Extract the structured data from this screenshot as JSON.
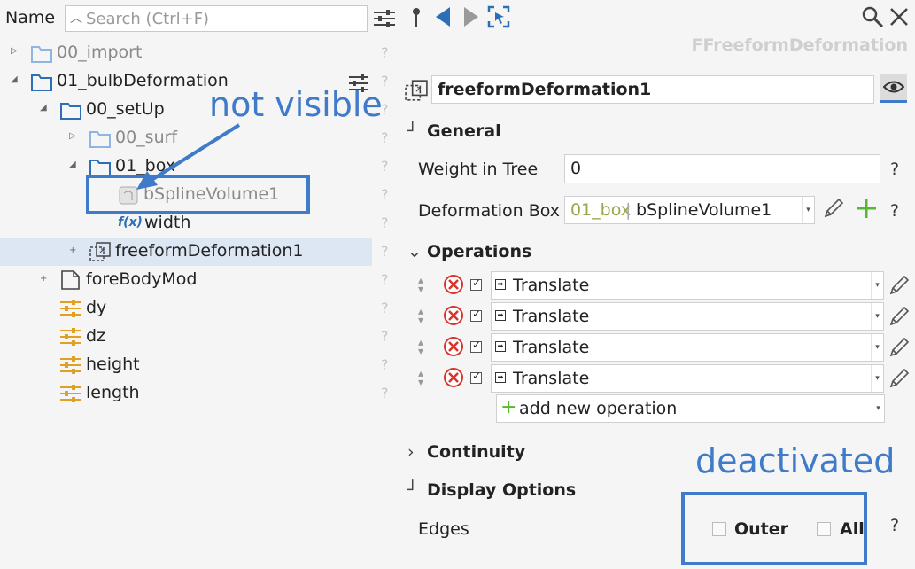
{
  "tree": {
    "header_label": "Name",
    "search_placeholder": "Search (Ctrl+F)",
    "items": [
      {
        "label": "00_import",
        "help": "?"
      },
      {
        "label": "01_bulbDeformation",
        "help": "?"
      },
      {
        "label": "00_setUp",
        "help": "?"
      },
      {
        "label": "00_surf",
        "help": "?"
      },
      {
        "label": "01_box",
        "help": "?"
      },
      {
        "label": "bSplineVolume1",
        "help": "?"
      },
      {
        "label": "width",
        "help": "?"
      },
      {
        "label": "freeformDeformation1",
        "help": "?"
      },
      {
        "label": "foreBodyMod",
        "help": "?"
      },
      {
        "label": "dy",
        "help": "?"
      },
      {
        "label": "dz",
        "help": "?"
      },
      {
        "label": "height",
        "help": "?"
      },
      {
        "label": "length",
        "help": "?"
      }
    ],
    "fx_symbol": "f(x)"
  },
  "annotations": {
    "not_visible": "not visible",
    "deactivated": "deactivated"
  },
  "inspector": {
    "class_name": "FFreeformDeformation",
    "object_name": "freeformDeformation1",
    "sections": {
      "general": "General",
      "operations": "Operations",
      "continuity": "Continuity",
      "display": "Display Options"
    },
    "general": {
      "weight_label": "Weight in Tree",
      "weight_value": "0",
      "box_label": "Deformation Box",
      "box_group": "01_box",
      "box_sep": "|",
      "box_value": "bSplineVolume1",
      "help": "?"
    },
    "operations": [
      {
        "label": "Translate"
      },
      {
        "label": "Translate"
      },
      {
        "label": "Translate"
      },
      {
        "label": "Translate"
      }
    ],
    "add_operation": "add new operation",
    "display": {
      "edges_label": "Edges",
      "outer_label": "Outer",
      "all_label": "All",
      "help": "?"
    }
  },
  "colors": {
    "accent": "#3f7bc8",
    "folder": "#2c6fb7",
    "delete": "#d9342b",
    "add": "#55b82e",
    "param": "#e0a022"
  }
}
